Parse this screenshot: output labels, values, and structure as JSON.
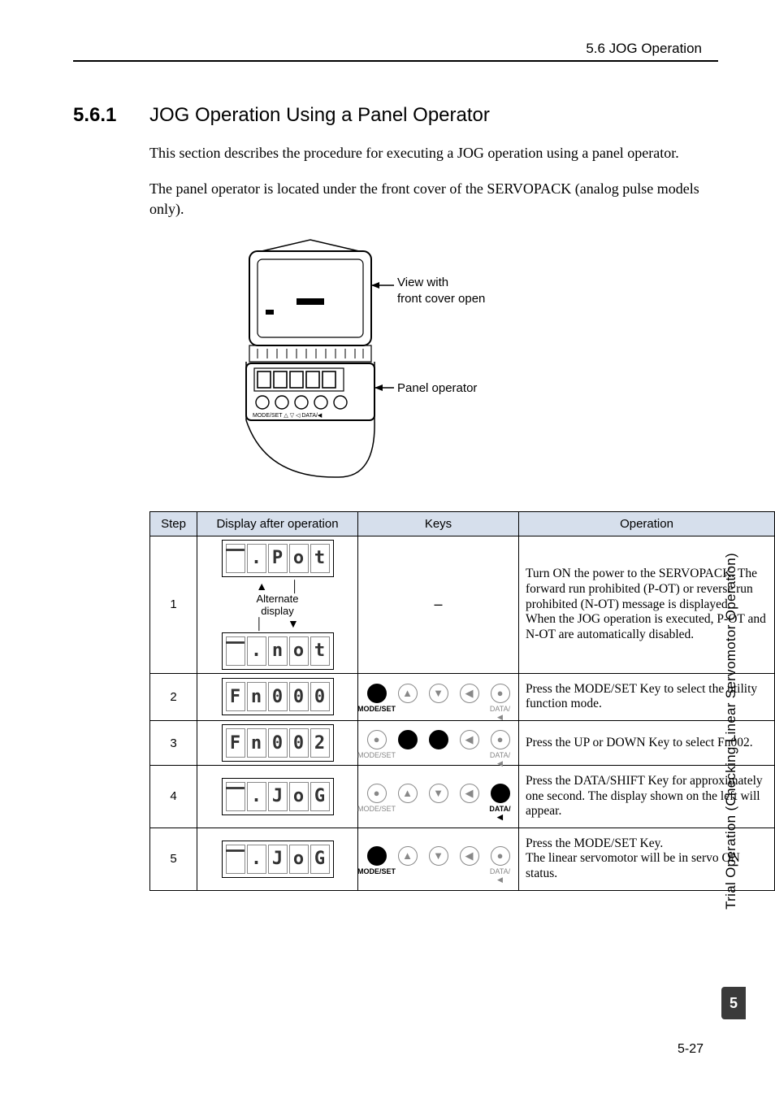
{
  "header": {
    "breadcrumb": "5.6  JOG Operation"
  },
  "section": {
    "number": "5.6.1",
    "title": "JOG Operation Using a Panel Operator"
  },
  "paragraphs": {
    "p1": "This section describes the procedure for executing a JOG operation using a panel operator.",
    "p2": "The panel operator is located under the front cover of the SERVOPACK (analog pulse models only)."
  },
  "diagram": {
    "label_view_1": "View with",
    "label_view_2": "front cover open",
    "label_panel": "Panel operator",
    "keys_text": "MODE/SET  △    ▽  ◁  DATA/◀"
  },
  "table": {
    "headers": {
      "step": "Step",
      "display": "Display after operation",
      "keys": "Keys",
      "operation": "Operation"
    },
    "rows": [
      {
        "step": "1",
        "display_top": [
          "⎺",
          ".",
          "P",
          "o",
          "t"
        ],
        "alt_label_top": "Alternate",
        "alt_label_bottom": "display",
        "display_bottom": [
          "⎺",
          ".",
          "n",
          "o",
          "t"
        ],
        "keys_dash": "–",
        "operation": "Turn ON the power to the SERVOPACK. The forward run prohibited (P-OT) or reverse run prohibited (N-OT) message is displayed.\nWhen the JOG operation is executed, P-OT and N-OT are automatically disabled."
      },
      {
        "step": "2",
        "display": [
          "F",
          "n",
          "0",
          "0",
          "0"
        ],
        "active_key": "modeset",
        "operation": "Press the MODE/SET Key to select the utility function mode."
      },
      {
        "step": "3",
        "display": [
          "F",
          "n",
          "0",
          "0",
          "2"
        ],
        "active_key": "updown",
        "operation": "Press the UP or DOWN  Key to select Fn002."
      },
      {
        "step": "4",
        "display": [
          "⎺",
          ".",
          "J",
          "o",
          "G"
        ],
        "active_key": "data",
        "operation": "Press the DATA/SHIFT Key for approximately one second. The display shown on the left will appear."
      },
      {
        "step": "5",
        "display": [
          "⎺",
          ".",
          "J",
          "o",
          "G"
        ],
        "active_key": "modeset",
        "operation": "Press the MODE/SET Key.\nThe linear servomotor will be in servo ON status."
      }
    ],
    "key_labels": {
      "modeset": "MODE/SET",
      "up": "▲",
      "down": "▼",
      "left": "◀",
      "data": "DATA/◀"
    }
  },
  "side": {
    "text": "Trial Operation (Checking Linear Servomotor Operation)",
    "chapter": "5"
  },
  "footer": {
    "page": "5-27"
  }
}
